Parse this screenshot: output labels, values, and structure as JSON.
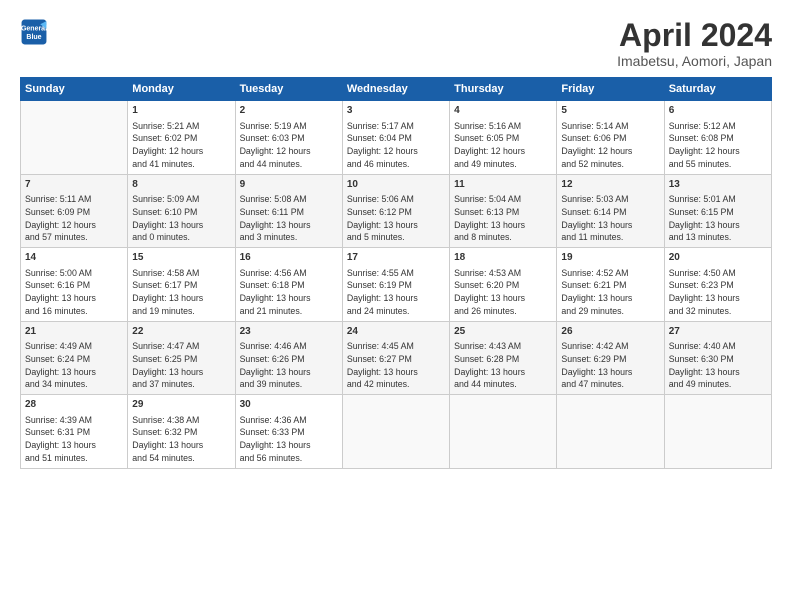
{
  "header": {
    "logo_line1": "General",
    "logo_line2": "Blue",
    "title": "April 2024",
    "subtitle": "Imabetsu, Aomori, Japan"
  },
  "weekdays": [
    "Sunday",
    "Monday",
    "Tuesday",
    "Wednesday",
    "Thursday",
    "Friday",
    "Saturday"
  ],
  "weeks": [
    [
      {
        "num": "",
        "info": ""
      },
      {
        "num": "1",
        "info": "Sunrise: 5:21 AM\nSunset: 6:02 PM\nDaylight: 12 hours\nand 41 minutes."
      },
      {
        "num": "2",
        "info": "Sunrise: 5:19 AM\nSunset: 6:03 PM\nDaylight: 12 hours\nand 44 minutes."
      },
      {
        "num": "3",
        "info": "Sunrise: 5:17 AM\nSunset: 6:04 PM\nDaylight: 12 hours\nand 46 minutes."
      },
      {
        "num": "4",
        "info": "Sunrise: 5:16 AM\nSunset: 6:05 PM\nDaylight: 12 hours\nand 49 minutes."
      },
      {
        "num": "5",
        "info": "Sunrise: 5:14 AM\nSunset: 6:06 PM\nDaylight: 12 hours\nand 52 minutes."
      },
      {
        "num": "6",
        "info": "Sunrise: 5:12 AM\nSunset: 6:08 PM\nDaylight: 12 hours\nand 55 minutes."
      }
    ],
    [
      {
        "num": "7",
        "info": "Sunrise: 5:11 AM\nSunset: 6:09 PM\nDaylight: 12 hours\nand 57 minutes."
      },
      {
        "num": "8",
        "info": "Sunrise: 5:09 AM\nSunset: 6:10 PM\nDaylight: 13 hours\nand 0 minutes."
      },
      {
        "num": "9",
        "info": "Sunrise: 5:08 AM\nSunset: 6:11 PM\nDaylight: 13 hours\nand 3 minutes."
      },
      {
        "num": "10",
        "info": "Sunrise: 5:06 AM\nSunset: 6:12 PM\nDaylight: 13 hours\nand 5 minutes."
      },
      {
        "num": "11",
        "info": "Sunrise: 5:04 AM\nSunset: 6:13 PM\nDaylight: 13 hours\nand 8 minutes."
      },
      {
        "num": "12",
        "info": "Sunrise: 5:03 AM\nSunset: 6:14 PM\nDaylight: 13 hours\nand 11 minutes."
      },
      {
        "num": "13",
        "info": "Sunrise: 5:01 AM\nSunset: 6:15 PM\nDaylight: 13 hours\nand 13 minutes."
      }
    ],
    [
      {
        "num": "14",
        "info": "Sunrise: 5:00 AM\nSunset: 6:16 PM\nDaylight: 13 hours\nand 16 minutes."
      },
      {
        "num": "15",
        "info": "Sunrise: 4:58 AM\nSunset: 6:17 PM\nDaylight: 13 hours\nand 19 minutes."
      },
      {
        "num": "16",
        "info": "Sunrise: 4:56 AM\nSunset: 6:18 PM\nDaylight: 13 hours\nand 21 minutes."
      },
      {
        "num": "17",
        "info": "Sunrise: 4:55 AM\nSunset: 6:19 PM\nDaylight: 13 hours\nand 24 minutes."
      },
      {
        "num": "18",
        "info": "Sunrise: 4:53 AM\nSunset: 6:20 PM\nDaylight: 13 hours\nand 26 minutes."
      },
      {
        "num": "19",
        "info": "Sunrise: 4:52 AM\nSunset: 6:21 PM\nDaylight: 13 hours\nand 29 minutes."
      },
      {
        "num": "20",
        "info": "Sunrise: 4:50 AM\nSunset: 6:23 PM\nDaylight: 13 hours\nand 32 minutes."
      }
    ],
    [
      {
        "num": "21",
        "info": "Sunrise: 4:49 AM\nSunset: 6:24 PM\nDaylight: 13 hours\nand 34 minutes."
      },
      {
        "num": "22",
        "info": "Sunrise: 4:47 AM\nSunset: 6:25 PM\nDaylight: 13 hours\nand 37 minutes."
      },
      {
        "num": "23",
        "info": "Sunrise: 4:46 AM\nSunset: 6:26 PM\nDaylight: 13 hours\nand 39 minutes."
      },
      {
        "num": "24",
        "info": "Sunrise: 4:45 AM\nSunset: 6:27 PM\nDaylight: 13 hours\nand 42 minutes."
      },
      {
        "num": "25",
        "info": "Sunrise: 4:43 AM\nSunset: 6:28 PM\nDaylight: 13 hours\nand 44 minutes."
      },
      {
        "num": "26",
        "info": "Sunrise: 4:42 AM\nSunset: 6:29 PM\nDaylight: 13 hours\nand 47 minutes."
      },
      {
        "num": "27",
        "info": "Sunrise: 4:40 AM\nSunset: 6:30 PM\nDaylight: 13 hours\nand 49 minutes."
      }
    ],
    [
      {
        "num": "28",
        "info": "Sunrise: 4:39 AM\nSunset: 6:31 PM\nDaylight: 13 hours\nand 51 minutes."
      },
      {
        "num": "29",
        "info": "Sunrise: 4:38 AM\nSunset: 6:32 PM\nDaylight: 13 hours\nand 54 minutes."
      },
      {
        "num": "30",
        "info": "Sunrise: 4:36 AM\nSunset: 6:33 PM\nDaylight: 13 hours\nand 56 minutes."
      },
      {
        "num": "",
        "info": ""
      },
      {
        "num": "",
        "info": ""
      },
      {
        "num": "",
        "info": ""
      },
      {
        "num": "",
        "info": ""
      }
    ]
  ]
}
